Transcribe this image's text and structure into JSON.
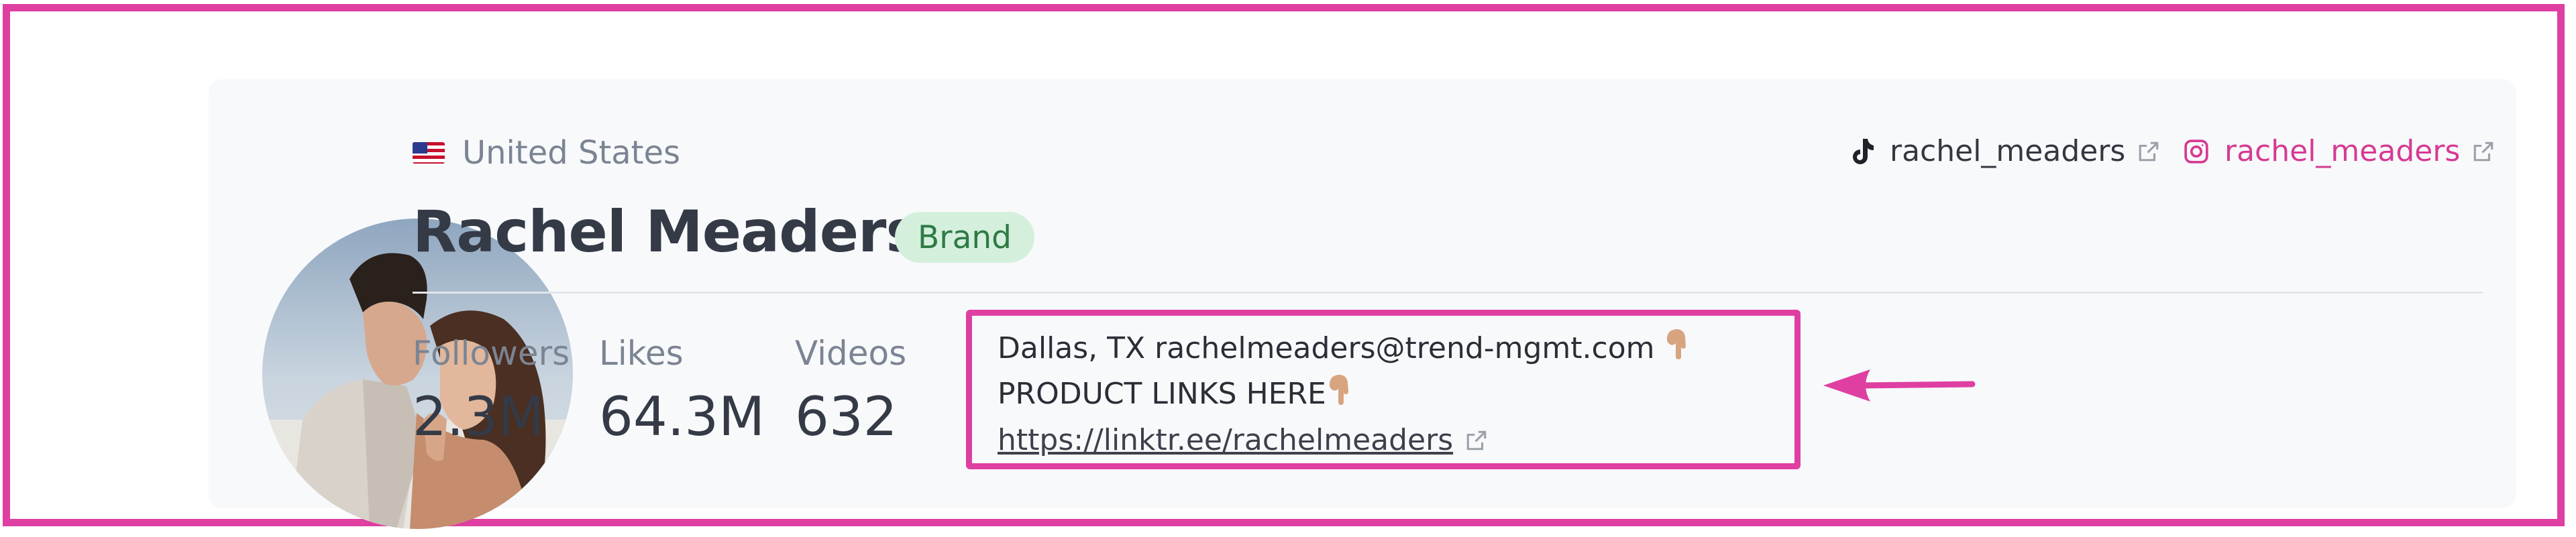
{
  "profile": {
    "country": "United States",
    "name": "Rachel Meaders",
    "badge": "Brand"
  },
  "socials": {
    "tiktok_handle": "rachel_meaders",
    "instagram_handle": "rachel_meaders"
  },
  "stats": [
    {
      "label": "Followers",
      "value": "2.3M"
    },
    {
      "label": "Likes",
      "value": "64.3M"
    },
    {
      "label": "Videos",
      "value": "632"
    }
  ],
  "bio": {
    "part1": "Dallas, TX rachelmeaders@trend-mgmt.com ",
    "part2": "PRODUCT LINKS HERE",
    "link": "https://linktr.ee/rachelmeaders"
  },
  "colors": {
    "highlight": "#de3fa1",
    "badge_bg": "#d4f0dc",
    "badge_text": "#2f7a45",
    "instagram": "#d63a93"
  },
  "icons": {
    "flag": "us-flag-icon",
    "tiktok": "tiktok-icon",
    "instagram": "instagram-icon",
    "external_link": "external-link-icon",
    "pointing_down": "pointing-down-hand-icon"
  }
}
